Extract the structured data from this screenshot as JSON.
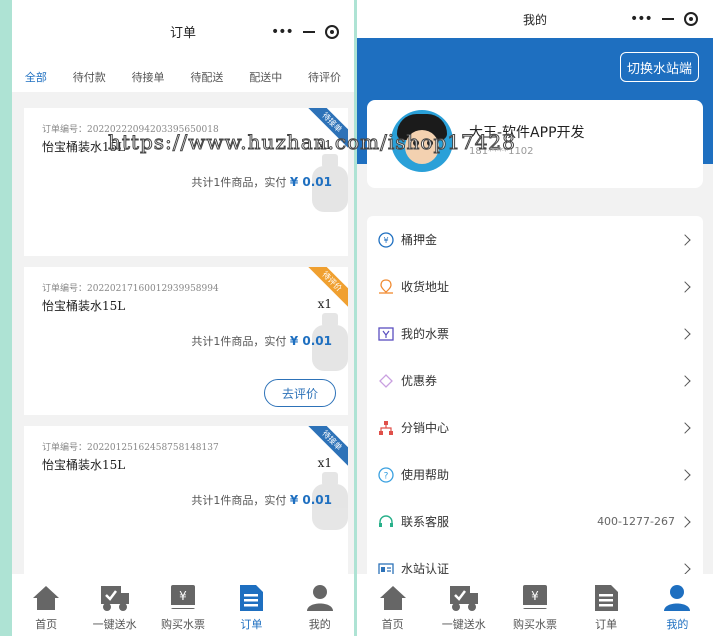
{
  "left": {
    "title": "订单",
    "tabs": [
      "全部",
      "待付款",
      "待接单",
      "待配送",
      "配送中",
      "待评价"
    ],
    "orders": [
      {
        "order_no": "订单编号：20220222094203395650018",
        "product": "怡宝桶装水15L",
        "qty": "x1",
        "summary": "共计1件商品，实付",
        "price": "¥ 0.01",
        "badge": "待接单",
        "badge_color": "#2d72b8"
      },
      {
        "order_no": "订单编号：20220217160012939958994",
        "product": "怡宝桶装水15L",
        "qty": "x1",
        "summary": "共计1件商品，实付",
        "price": "¥ 0.01",
        "badge": "待评价",
        "badge_color": "#f0a030",
        "action": "去评价"
      },
      {
        "order_no": "订单编号：20220125162458758148137",
        "product": "怡宝桶装水15L",
        "qty": "x1",
        "summary": "共计1件商品，实付",
        "price": "¥ 0.01",
        "badge": "待接单",
        "badge_color": "#2d72b8"
      }
    ]
  },
  "right": {
    "title": "我的",
    "switch_label": "切换水站端",
    "user": {
      "name": "大王-软件APP开发",
      "phone": "181****1102"
    },
    "menu": [
      {
        "label": "桶押金",
        "icon": "yen-circle-icon"
      },
      {
        "label": "收货地址",
        "icon": "location-icon"
      },
      {
        "label": "我的水票",
        "icon": "ticket-icon"
      },
      {
        "label": "优惠券",
        "icon": "coupon-icon"
      },
      {
        "label": "分销中心",
        "icon": "network-icon"
      },
      {
        "label": "使用帮助",
        "icon": "help-icon"
      },
      {
        "label": "联系客服",
        "icon": "headset-icon",
        "value": "400-1277-267"
      },
      {
        "label": "水站认证",
        "icon": "id-card-icon"
      }
    ]
  },
  "tabbar": {
    "items": [
      "首页",
      "一键送水",
      "购买水票",
      "订单",
      "我的"
    ]
  },
  "watermark": "https://www.huzhan.com/ishop17428",
  "accent": "#1e6fc0"
}
